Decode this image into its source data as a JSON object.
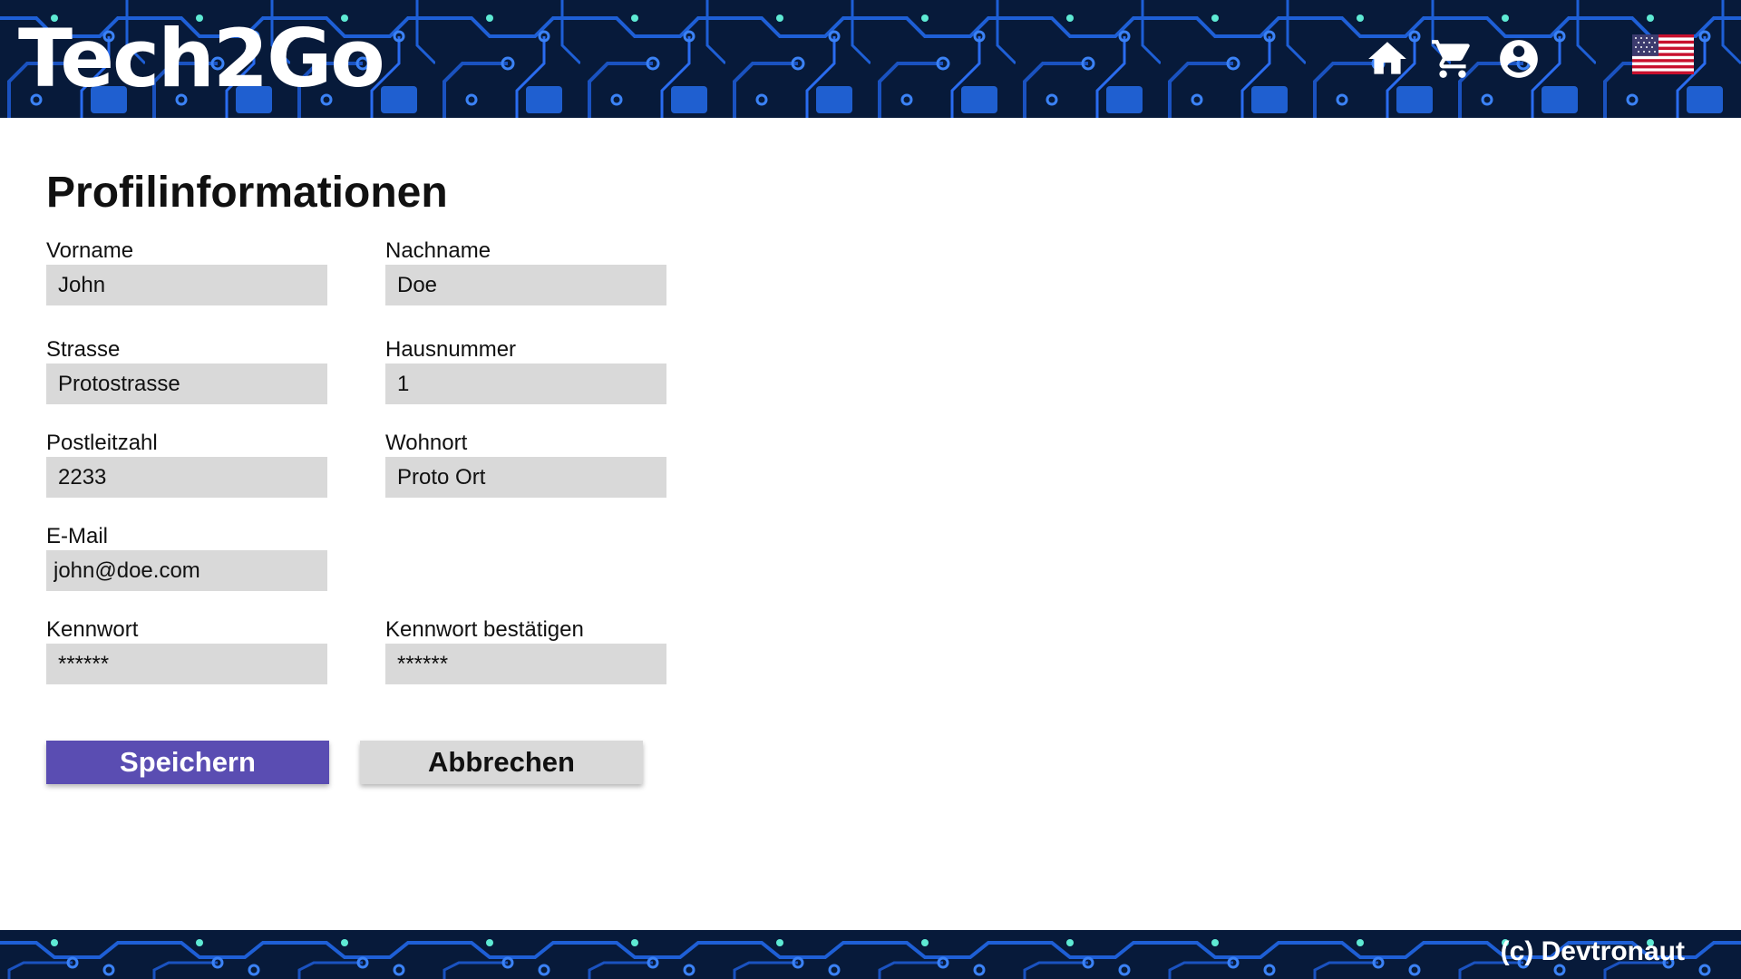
{
  "header": {
    "brand": "Tech2Go",
    "nav": [
      {
        "icon": "home-icon"
      },
      {
        "icon": "shopping-cart-icon"
      },
      {
        "icon": "account-circle-icon"
      }
    ],
    "language_icon": "us-flag-icon"
  },
  "main": {
    "title": "Profilinformationen",
    "fields": {
      "first_name": {
        "label": "Vorname",
        "value": "John"
      },
      "last_name": {
        "label": "Nachname",
        "value": "Doe"
      },
      "street": {
        "label": "Strasse",
        "value": "Protostrasse"
      },
      "house_number": {
        "label": "Hausnummer",
        "value": "1"
      },
      "postal_code": {
        "label": "Postleitzahl",
        "value": "2233"
      },
      "city": {
        "label": "Wohnort",
        "value": "Proto Ort"
      },
      "email": {
        "label": "E-Mail",
        "value": "john@doe.com"
      },
      "password": {
        "label": "Kennwort",
        "value": "******"
      },
      "password_confirm": {
        "label": "Kennwort bestätigen",
        "value": "******"
      }
    },
    "buttons": {
      "save": "Speichern",
      "cancel": "Abbrechen"
    }
  },
  "footer": {
    "copyright": "(c) Devtronaut"
  },
  "colors": {
    "primary": "#5a4db2",
    "secondary_button": "#d9d9d9",
    "input_background": "#d9d9d9",
    "banner_background": "#071a3a",
    "circuit_trace": "#1e5fd6"
  }
}
